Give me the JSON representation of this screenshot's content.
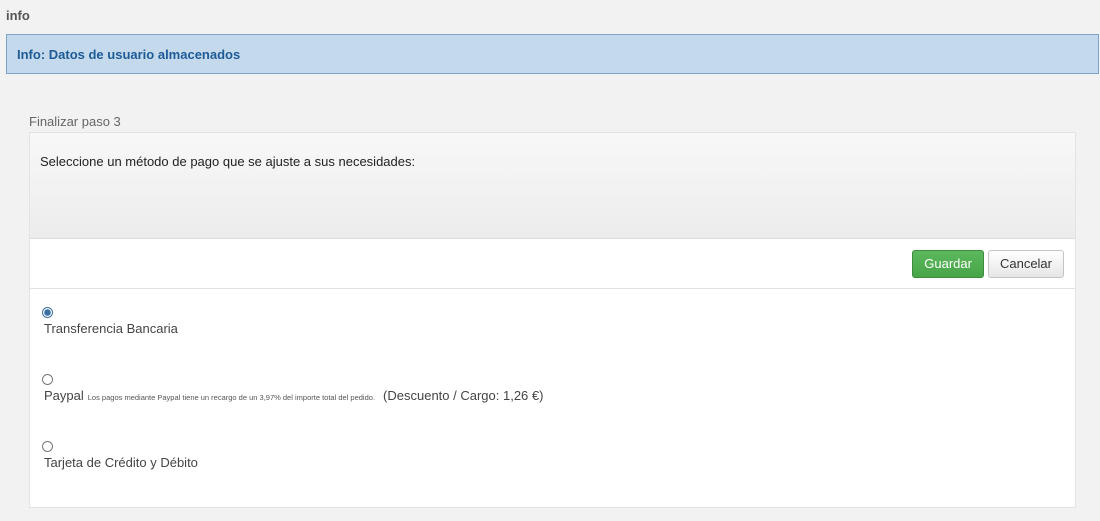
{
  "page": {
    "label": "info"
  },
  "info_bar": {
    "message": "Info: Datos de usuario almacenados"
  },
  "step": {
    "label": "Finalizar paso 3"
  },
  "panel": {
    "heading": "Seleccione un método de pago que se ajuste a sus necesidades:"
  },
  "actions": {
    "save_label": "Guardar",
    "cancel_label": "Cancelar"
  },
  "payment_methods": [
    {
      "label": "Transferencia Bancaria",
      "selected": true,
      "note": "",
      "extra": ""
    },
    {
      "label": "Paypal",
      "selected": false,
      "note": "Los pagos mediante Paypal tiene un recargo de un 3,97% del importe total del pedido.",
      "extra": "(Descuento / Cargo: 1,26 €)"
    },
    {
      "label": "Tarjeta de Crédito y Débito",
      "selected": false,
      "note": "",
      "extra": ""
    }
  ],
  "colors": {
    "info_bg": "#c5d9ec",
    "info_text": "#1d5b97",
    "save_button": "#5cb85c"
  }
}
